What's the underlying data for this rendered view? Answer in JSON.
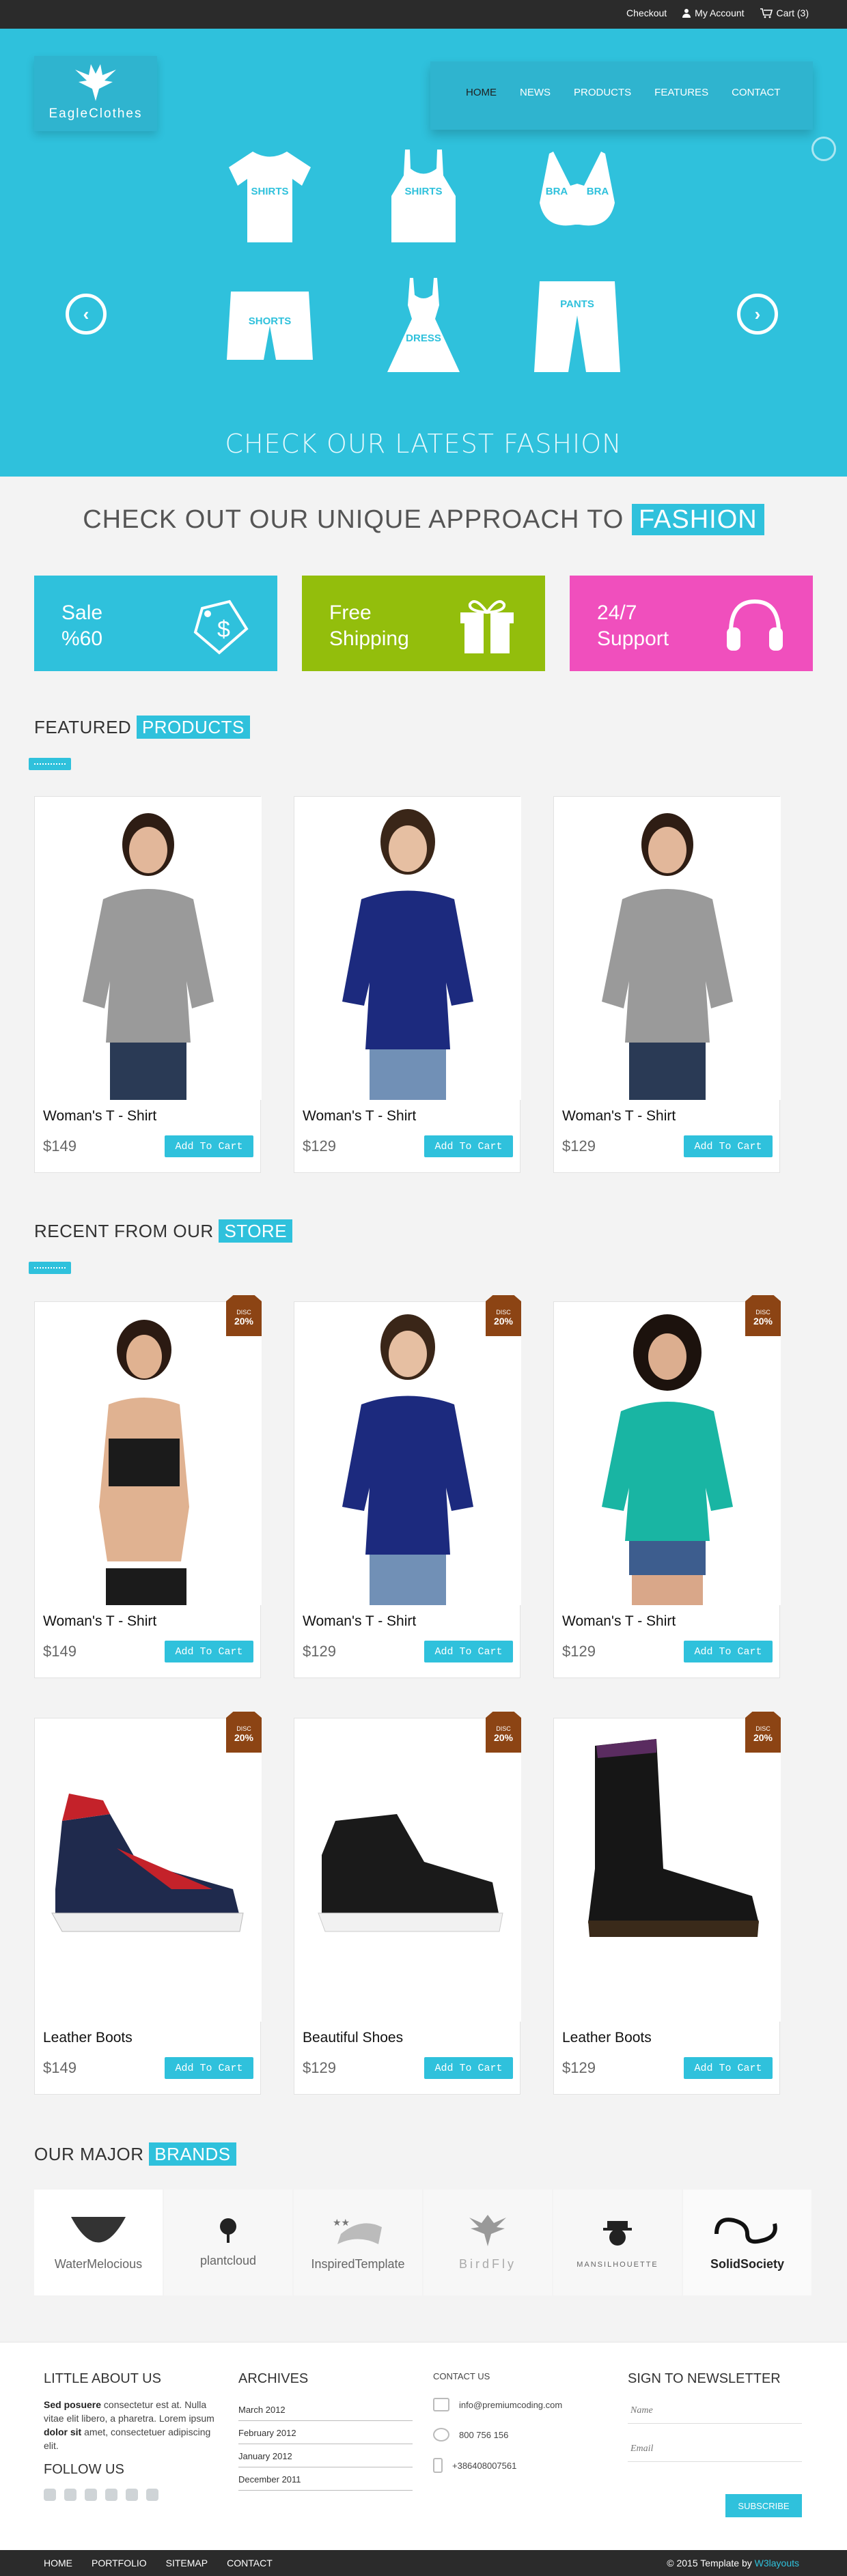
{
  "topbar": {
    "checkout": "Checkout",
    "account": "My Account",
    "cart": "Cart (3)"
  },
  "logo": {
    "text": "EagleClothes"
  },
  "nav": {
    "items": [
      "HOME",
      "NEWS",
      "PRODUCTS",
      "FEATURES",
      "CONTACT"
    ]
  },
  "hero": {
    "items": [
      "SHIRTS",
      "SHIRTS",
      "BRA",
      "BRA",
      "SHORTS",
      "DRESS",
      "PANTS"
    ],
    "caption": "CHECK OUR LATEST FASHION"
  },
  "approach": {
    "text": "CHECK OUT OUR UNIQUE APPROACH TO",
    "highlight": "FASHION"
  },
  "features": [
    {
      "line1": "Sale",
      "line2": "%60",
      "color": "#2fc1dc"
    },
    {
      "line1": "Free",
      "line2": "Shipping",
      "color": "#93be0c"
    },
    {
      "line1": "24/7",
      "line2": "Support",
      "color": "#f04fbd"
    }
  ],
  "featured": {
    "title": "FEATURED",
    "highlight": "PRODUCTS",
    "products": [
      {
        "name": "Woman's T - Shirt",
        "price": "$149",
        "button": "Add To Cart"
      },
      {
        "name": "Woman's T - Shirt",
        "price": "$129",
        "button": "Add To Cart"
      },
      {
        "name": "Woman's T - Shirt",
        "price": "$129",
        "button": "Add To Cart"
      }
    ]
  },
  "recent": {
    "title": "RECENT FROM OUR",
    "highlight": "STORE",
    "tag_label": "DISC",
    "tag_value": "20%",
    "products": [
      {
        "name": "Woman's T - Shirt",
        "price": "$149",
        "button": "Add To Cart"
      },
      {
        "name": "Woman's T - Shirt",
        "price": "$129",
        "button": "Add To Cart"
      },
      {
        "name": "Woman's T - Shirt",
        "price": "$129",
        "button": "Add To Cart"
      },
      {
        "name": "Leather Boots",
        "price": "$149",
        "button": "Add To Cart"
      },
      {
        "name": "Beautiful Shoes",
        "price": "$129",
        "button": "Add To Cart"
      },
      {
        "name": "Leather Boots",
        "price": "$129",
        "button": "Add To Cart"
      }
    ]
  },
  "brands": {
    "title": "OUR MAJOR",
    "highlight": "BRANDS",
    "items": [
      "WaterMelocious",
      "plantcloud",
      "InspiredTemplate",
      "BirdFly",
      "MANSILHOUETTE",
      "SolidSociety"
    ]
  },
  "footer": {
    "about": {
      "title": "LITTLE ABOUT US",
      "b1": "Sed posuere",
      "t1": " consectetur est at. Nulla vitae elit libero, a pharetra. Lorem ipsum ",
      "b2": "dolor sit",
      "t2": " amet, consectetuer adipiscing elit."
    },
    "follow": "FOLLOW US",
    "archives": {
      "title": "ARCHIVES",
      "items": [
        "March 2012",
        "February 2012",
        "January 2012",
        "December 2011"
      ]
    },
    "contact": {
      "title": "CONTACT US",
      "email": "info@premiumcoding.com",
      "phone": "800 756 156",
      "mobile": "+386408007561"
    },
    "newsletter": {
      "title": "SIGN TO NEWSLETTER",
      "name_placeholder": "Name",
      "email_placeholder": "Email",
      "button": "SUBSCRIBE"
    }
  },
  "bottombar": {
    "links": [
      "HOME",
      "PORTFOLIO",
      "SITEMAP",
      "CONTACT"
    ],
    "copyright": "© 2015 Template by",
    "brand": "W3layouts"
  }
}
